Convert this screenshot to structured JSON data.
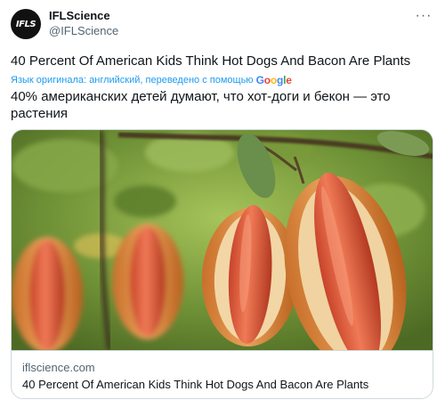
{
  "author": {
    "avatar_text": "IFLS",
    "display_name": "IFLScience",
    "handle": "@IFLScience"
  },
  "more_icon": "more-horizontal-icon",
  "tweet": {
    "text": "40 Percent Of American Kids Think Hot Dogs And Bacon Are Plants",
    "translation_label": "Язык оригинала: английский, переведено с помощью",
    "translation_provider": "Google",
    "translated_text": "40% американских детей думают, что хот-доги и бекон — это растения"
  },
  "card": {
    "domain": "iflscience.com",
    "title": "40 Percent Of American Kids Think Hot Dogs And Bacon Are Plants"
  },
  "colors": {
    "link_blue": "#1d9bf0",
    "secondary_text": "#536471",
    "border": "#cfd9de"
  }
}
